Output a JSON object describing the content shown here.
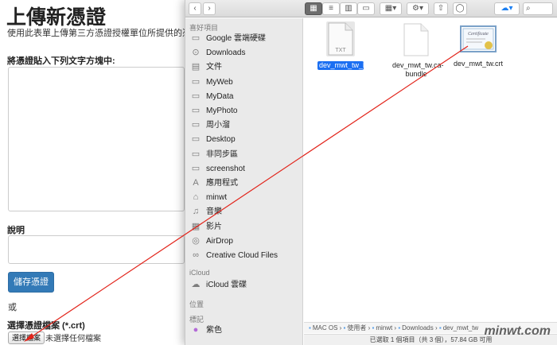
{
  "web": {
    "title": "上傳新憑證",
    "description": "使用此表單上傳第三方憑證授權單位所提供的憑證。",
    "paste_label": "將憑證貼入下列文字方塊中:",
    "explain_label": "說明",
    "save_button": "儲存憑證",
    "or_text": "或",
    "choose_file_label": "選擇憑證檔案 (*.crt)",
    "choose_file_button": "選擇檔案",
    "no_file_text": "未選擇任何檔案"
  },
  "finder": {
    "sidebar_sections": {
      "favorites": "喜好項目",
      "icloud": "iCloud",
      "locations": "位置",
      "tags": "標記"
    },
    "favorites": [
      {
        "label": "Google 雲端硬碟",
        "icon": "folder-icon"
      },
      {
        "label": "Downloads",
        "icon": "downloads-icon"
      },
      {
        "label": "文件",
        "icon": "documents-icon"
      },
      {
        "label": "MyWeb",
        "icon": "folder-icon"
      },
      {
        "label": "MyData",
        "icon": "folder-icon"
      },
      {
        "label": "MyPhoto",
        "icon": "folder-icon"
      },
      {
        "label": "周小溜",
        "icon": "folder-icon"
      },
      {
        "label": "Desktop",
        "icon": "folder-icon"
      },
      {
        "label": "非同步區",
        "icon": "folder-icon"
      },
      {
        "label": "screenshot",
        "icon": "folder-icon"
      },
      {
        "label": "應用程式",
        "icon": "applications-icon"
      },
      {
        "label": "minwt",
        "icon": "home-icon"
      },
      {
        "label": "音樂",
        "icon": "music-icon"
      },
      {
        "label": "影片",
        "icon": "movies-icon"
      },
      {
        "label": "AirDrop",
        "icon": "airdrop-icon"
      },
      {
        "label": "Creative Cloud Files",
        "icon": "creative-cloud-icon"
      }
    ],
    "icloud_items": [
      {
        "label": "iCloud 雲碟",
        "icon": "cloud-icon"
      }
    ],
    "tag_items": [
      {
        "label": "紫色",
        "icon": "tag-dot-icon",
        "color": "#b36ad7"
      }
    ],
    "files": [
      {
        "name": "dev_mwt_tw_key.txt",
        "type": "TXT",
        "selected": true
      },
      {
        "name": "dev_mwt_tw.ca-bundle",
        "type": "",
        "selected": false
      },
      {
        "name": "dev_mwt_tw.crt",
        "type": "certificate",
        "selected": false
      }
    ],
    "path": [
      "MAC OS",
      "使用者",
      "minwt",
      "Downloads",
      "dev_mwt_tw"
    ],
    "status": "已選取 1 個項目（共 3 個），57.84 GB 可用",
    "selection_color": "#1b6ff2"
  },
  "annotation": {
    "arrow_color": "#e2231a"
  },
  "watermark": "minwt.com"
}
